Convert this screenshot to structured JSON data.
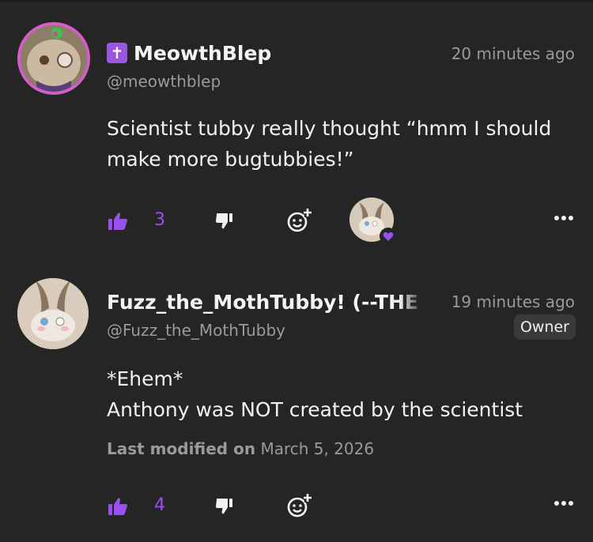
{
  "comments": [
    {
      "badge": "✝",
      "name": "MeowthBlep",
      "handle": "@meowthblep",
      "time": "20 minutes ago",
      "body_lines": [
        "Scientist tubby really thought “hmm I should",
        "make more bugtubbies!”"
      ],
      "likes": "3"
    },
    {
      "name": "Fuzz_the_MothTubby! (--THE I",
      "handle": "@Fuzz_the_MothTubby",
      "time": "19 minutes ago",
      "role": "Owner",
      "body_lines": [
        "*Ehem*",
        "Anthony was NOT created by the scientist"
      ],
      "modified_label": "Last modified on",
      "modified_date": "March 5, 2026",
      "likes": "4"
    }
  ],
  "colors": {
    "background": "#252525",
    "accent": "#9b4ff0",
    "muted": "#9a9a9a",
    "avatar_ring": "#d25ec7"
  },
  "icons": {
    "like": "thumbs-up-icon",
    "dislike": "thumbs-down-icon",
    "react": "add-reaction-icon",
    "more": "more-icon",
    "heart": "heart-icon"
  }
}
